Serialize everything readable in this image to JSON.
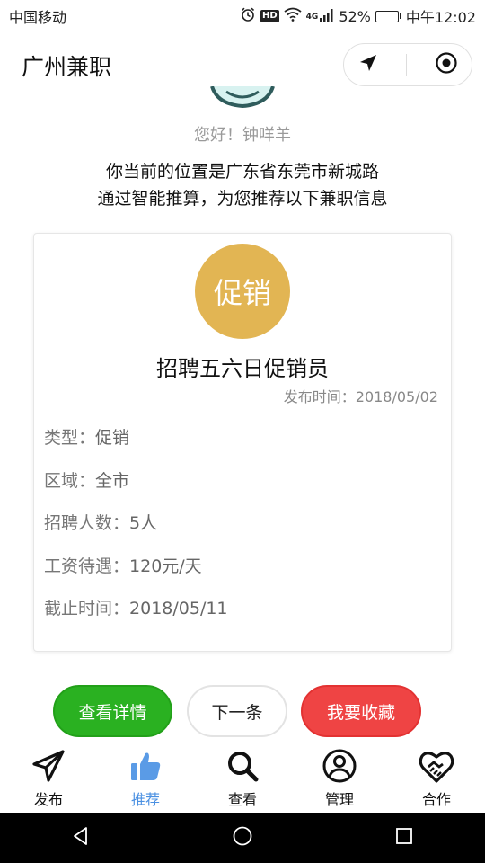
{
  "status_bar": {
    "carrier": "中国移动",
    "network": "4G",
    "battery_percent": "52%",
    "battery_level": 0.52,
    "time": "中午12:02",
    "hd_label": "HD"
  },
  "nav_bar": {
    "title": "广州兼职"
  },
  "greeting": "您好！钟咩羊",
  "location": {
    "line1": "你当前的位置是广东省东莞市新城路",
    "line2": "通过智能推算，为您推荐以下兼职信息"
  },
  "job_card": {
    "category_badge": "促销",
    "title": "招聘五六日促销员",
    "publish_time": "发布时间：2018/05/02",
    "fields": [
      {
        "label": "类型：",
        "value": "促销"
      },
      {
        "label": "区域：",
        "value": "全市"
      },
      {
        "label": "招聘人数：",
        "value": "5人"
      },
      {
        "label": "工资待遇：",
        "value": "120元/天"
      },
      {
        "label": "截止时间：",
        "value": "2018/05/11"
      }
    ]
  },
  "actions": {
    "detail": "查看详情",
    "next": "下一条",
    "favorite": "我要收藏"
  },
  "tabs": [
    {
      "label": "发布",
      "icon": "send-icon",
      "active": false
    },
    {
      "label": "推荐",
      "icon": "thumbs-up-icon",
      "active": true
    },
    {
      "label": "查看",
      "icon": "search-icon",
      "active": false
    },
    {
      "label": "管理",
      "icon": "user-circle-icon",
      "active": false
    },
    {
      "label": "合作",
      "icon": "handshake-icon",
      "active": false
    }
  ],
  "colors": {
    "badge_gold": "#e2b553",
    "detail_green": "#2ab121",
    "favorite_red": "#ef4444",
    "active_tab_blue": "#4a90e2"
  }
}
